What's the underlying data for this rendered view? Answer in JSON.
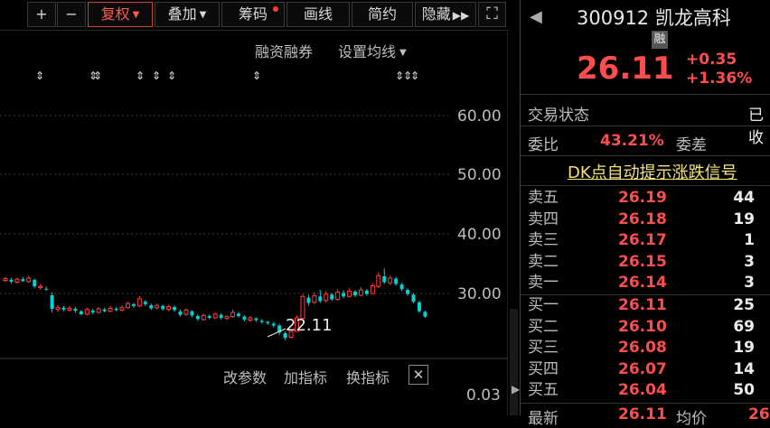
{
  "toolbar": {
    "zoom_in": "+",
    "zoom_out": "−",
    "fuquan": "复权",
    "diejia": "叠加",
    "chouma": "筹码",
    "huaxian": "画线",
    "jianyue": "简约",
    "yincang": "隐藏",
    "expand_icon": "⛶"
  },
  "chart_links": {
    "margin": "融资融券",
    "ma_settings": "设置均线"
  },
  "chart_data": {
    "type": "candlestick",
    "y_ticks": [
      "60.00",
      "50.00",
      "40.00",
      "30.00"
    ],
    "annotation_low": "22.11",
    "sub_ticks": [
      "0.03"
    ],
    "candles": [
      {
        "o": 32.2,
        "c": 32.5,
        "h": 32.8,
        "l": 31.9
      },
      {
        "o": 32.3,
        "c": 32.0,
        "h": 32.6,
        "l": 31.7
      },
      {
        "o": 31.9,
        "c": 32.4,
        "h": 32.7,
        "l": 31.6
      },
      {
        "o": 32.4,
        "c": 32.1,
        "h": 32.8,
        "l": 31.9
      },
      {
        "o": 32.0,
        "c": 32.6,
        "h": 33.0,
        "l": 31.8
      },
      {
        "o": 32.3,
        "c": 31.2,
        "h": 32.5,
        "l": 30.9
      },
      {
        "o": 31.0,
        "c": 31.2,
        "h": 31.6,
        "l": 30.6
      },
      {
        "o": 30.8,
        "c": 30.7,
        "h": 31.2,
        "l": 30.4
      },
      {
        "o": 29.7,
        "c": 27.4,
        "h": 30.2,
        "l": 26.8
      },
      {
        "o": 27.3,
        "c": 27.6,
        "h": 28.0,
        "l": 26.9
      },
      {
        "o": 27.6,
        "c": 27.3,
        "h": 27.9,
        "l": 27.0
      },
      {
        "o": 27.2,
        "c": 27.5,
        "h": 27.9,
        "l": 26.9
      },
      {
        "o": 27.4,
        "c": 27.1,
        "h": 27.7,
        "l": 26.7
      },
      {
        "o": 27.0,
        "c": 26.5,
        "h": 27.2,
        "l": 26.3
      },
      {
        "o": 26.5,
        "c": 27.3,
        "h": 27.6,
        "l": 26.3
      },
      {
        "o": 27.1,
        "c": 26.8,
        "h": 27.4,
        "l": 26.5
      },
      {
        "o": 26.8,
        "c": 27.4,
        "h": 27.7,
        "l": 26.6
      },
      {
        "o": 27.3,
        "c": 27.0,
        "h": 27.6,
        "l": 26.8
      },
      {
        "o": 27.0,
        "c": 27.5,
        "h": 27.9,
        "l": 26.8
      },
      {
        "o": 27.4,
        "c": 27.2,
        "h": 27.7,
        "l": 27.0
      },
      {
        "o": 27.2,
        "c": 27.6,
        "h": 28.0,
        "l": 27.0
      },
      {
        "o": 27.6,
        "c": 28.3,
        "h": 28.6,
        "l": 27.4
      },
      {
        "o": 28.2,
        "c": 27.9,
        "h": 28.4,
        "l": 27.6
      },
      {
        "o": 27.9,
        "c": 29.1,
        "h": 29.6,
        "l": 27.7
      },
      {
        "o": 28.6,
        "c": 28.2,
        "h": 28.9,
        "l": 27.9
      },
      {
        "o": 28.0,
        "c": 27.5,
        "h": 28.3,
        "l": 27.2
      },
      {
        "o": 27.6,
        "c": 28.0,
        "h": 28.3,
        "l": 27.3
      },
      {
        "o": 27.9,
        "c": 27.4,
        "h": 28.1,
        "l": 27.1
      },
      {
        "o": 27.3,
        "c": 27.8,
        "h": 28.1,
        "l": 27.0
      },
      {
        "o": 27.7,
        "c": 27.2,
        "h": 28.0,
        "l": 26.9
      },
      {
        "o": 27.0,
        "c": 26.4,
        "h": 27.3,
        "l": 26.1
      },
      {
        "o": 26.5,
        "c": 27.2,
        "h": 27.5,
        "l": 26.2
      },
      {
        "o": 27.0,
        "c": 26.3,
        "h": 27.2,
        "l": 26.0
      },
      {
        "o": 26.2,
        "c": 25.7,
        "h": 26.5,
        "l": 25.4
      },
      {
        "o": 25.6,
        "c": 26.3,
        "h": 26.6,
        "l": 25.4
      },
      {
        "o": 26.2,
        "c": 25.9,
        "h": 26.5,
        "l": 25.6
      },
      {
        "o": 25.9,
        "c": 26.5,
        "h": 26.8,
        "l": 25.7
      },
      {
        "o": 26.4,
        "c": 25.9,
        "h": 26.7,
        "l": 25.6
      },
      {
        "o": 25.8,
        "c": 26.1,
        "h": 26.4,
        "l": 25.5
      },
      {
        "o": 26.1,
        "c": 26.8,
        "h": 27.3,
        "l": 25.9
      },
      {
        "o": 26.6,
        "c": 26.2,
        "h": 26.9,
        "l": 25.9
      },
      {
        "o": 26.1,
        "c": 25.6,
        "h": 26.3,
        "l": 25.3
      },
      {
        "o": 25.5,
        "c": 25.9,
        "h": 26.2,
        "l": 25.2
      },
      {
        "o": 25.8,
        "c": 25.5,
        "h": 26.0,
        "l": 25.2
      },
      {
        "o": 25.4,
        "c": 25.2,
        "h": 25.7,
        "l": 24.9
      },
      {
        "o": 25.2,
        "c": 25.0,
        "h": 25.4,
        "l": 24.7
      },
      {
        "o": 24.9,
        "c": 24.6,
        "h": 25.2,
        "l": 24.3
      },
      {
        "o": 24.6,
        "c": 23.4,
        "h": 24.9,
        "l": 23.0
      },
      {
        "o": 23.3,
        "c": 22.5,
        "h": 23.6,
        "l": 22.11
      },
      {
        "o": 22.6,
        "c": 23.6,
        "h": 23.9,
        "l": 22.4
      },
      {
        "o": 23.6,
        "c": 25.9,
        "h": 26.3,
        "l": 23.5
      },
      {
        "o": 25.8,
        "c": 29.5,
        "h": 29.9,
        "l": 25.6
      },
      {
        "o": 29.3,
        "c": 28.4,
        "h": 29.8,
        "l": 27.9
      },
      {
        "o": 28.5,
        "c": 29.6,
        "h": 30.2,
        "l": 28.2
      },
      {
        "o": 29.5,
        "c": 28.7,
        "h": 30.6,
        "l": 28.4
      },
      {
        "o": 28.8,
        "c": 29.9,
        "h": 30.4,
        "l": 28.5
      },
      {
        "o": 29.8,
        "c": 29.0,
        "h": 30.1,
        "l": 28.7
      },
      {
        "o": 29.0,
        "c": 30.2,
        "h": 30.7,
        "l": 28.8
      },
      {
        "o": 30.1,
        "c": 29.5,
        "h": 30.5,
        "l": 29.2
      },
      {
        "o": 29.5,
        "c": 30.4,
        "h": 30.9,
        "l": 29.3
      },
      {
        "o": 30.3,
        "c": 29.7,
        "h": 30.6,
        "l": 29.4
      },
      {
        "o": 29.7,
        "c": 30.6,
        "h": 31.1,
        "l": 29.5
      },
      {
        "o": 30.5,
        "c": 29.9,
        "h": 30.8,
        "l": 29.6
      },
      {
        "o": 30.0,
        "c": 31.3,
        "h": 31.7,
        "l": 29.8
      },
      {
        "o": 31.2,
        "c": 33.0,
        "h": 33.6,
        "l": 30.9
      },
      {
        "o": 32.9,
        "c": 31.9,
        "h": 34.2,
        "l": 31.6
      },
      {
        "o": 31.8,
        "c": 32.6,
        "h": 33.0,
        "l": 31.4
      },
      {
        "o": 32.5,
        "c": 31.6,
        "h": 32.8,
        "l": 31.3
      },
      {
        "o": 31.5,
        "c": 30.7,
        "h": 31.8,
        "l": 30.4
      },
      {
        "o": 30.6,
        "c": 29.9,
        "h": 30.9,
        "l": 29.6
      },
      {
        "o": 29.8,
        "c": 28.6,
        "h": 30.1,
        "l": 28.3
      },
      {
        "o": 28.5,
        "c": 27.0,
        "h": 28.8,
        "l": 26.7
      },
      {
        "o": 26.9,
        "c": 26.1,
        "h": 27.1,
        "l": 25.9
      }
    ]
  },
  "sub_links": {
    "params": "改参数",
    "add_indicator": "加指标",
    "switch_indicator": "换指标",
    "close_icon": "✕"
  },
  "panel": {
    "code": "300912",
    "name": "凯龙高科",
    "rong_badge": "融",
    "price": "26.11",
    "change": "+0.35",
    "change_pct": "+1.36%",
    "trade_state_label": "交易状态",
    "trade_state_value": "已收",
    "weibi_label": "委比",
    "weibi_value": "43.21%",
    "weicha_label": "委差",
    "dk_signal": "DK点自动提示涨跌信号",
    "asks": [
      {
        "label": "卖五",
        "price": "26.19",
        "vol": "44"
      },
      {
        "label": "卖四",
        "price": "26.18",
        "vol": "19"
      },
      {
        "label": "卖三",
        "price": "26.17",
        "vol": "1"
      },
      {
        "label": "卖二",
        "price": "26.15",
        "vol": "3"
      },
      {
        "label": "卖一",
        "price": "26.14",
        "vol": "3"
      }
    ],
    "bids": [
      {
        "label": "买一",
        "price": "26.11",
        "vol": "25"
      },
      {
        "label": "买二",
        "price": "26.10",
        "vol": "69"
      },
      {
        "label": "买三",
        "price": "26.08",
        "vol": "19"
      },
      {
        "label": "买四",
        "price": "26.07",
        "vol": "14"
      },
      {
        "label": "买五",
        "price": "26.04",
        "vol": "50"
      }
    ],
    "latest_label": "最新",
    "latest_value": "26.11",
    "avg_label": "均价",
    "avg_value": "26"
  }
}
